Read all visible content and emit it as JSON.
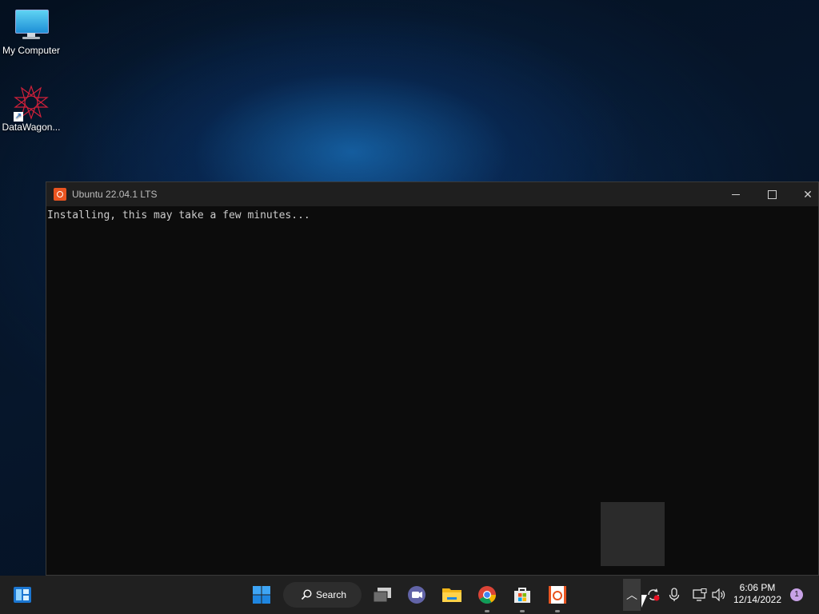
{
  "desktop": {
    "icons": [
      {
        "label": "My Computer",
        "icon": "monitor-icon"
      },
      {
        "label": "DataWagon...",
        "icon": "datawagon-logo-icon"
      }
    ]
  },
  "window": {
    "title": "Ubuntu 22.04.1 LTS",
    "console_text": "Installing, this may take a few minutes..."
  },
  "taskbar": {
    "search_label": "Search",
    "apps": [
      "widgets-icon",
      "start-icon",
      "task-view-icon",
      "chat-icon",
      "file-explorer-icon",
      "chrome-icon",
      "store-icon",
      "ubuntu-icon"
    ]
  },
  "tray": {
    "time": "6:06 PM",
    "date": "12/14/2022",
    "notification_count": "1"
  }
}
